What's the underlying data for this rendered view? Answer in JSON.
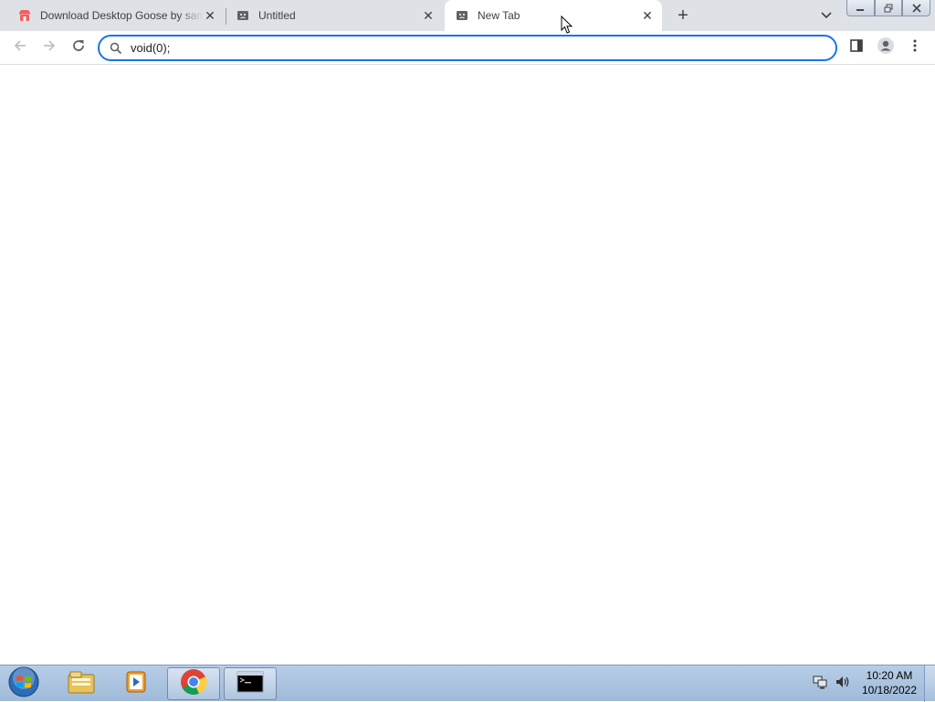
{
  "browser": {
    "tabs": [
      {
        "title": "Download Desktop Goose by sam",
        "favicon": "itch-io-icon",
        "active": false
      },
      {
        "title": "Untitled",
        "favicon": "sad-face-page-icon",
        "active": false
      },
      {
        "title": "New Tab",
        "favicon": "sad-face-page-icon",
        "active": true
      }
    ],
    "new_tab_label": "+",
    "omnibox": {
      "value": "void(0);"
    },
    "accent_color": "#1a73e8"
  },
  "taskbar": {
    "pinned": [
      "windows-start-orb-icon",
      "windows-explorer-icon",
      "media-player-icon",
      "chrome-icon",
      "command-prompt-icon"
    ],
    "clock": {
      "time": "10:20 AM",
      "date": "10/18/2022"
    }
  }
}
